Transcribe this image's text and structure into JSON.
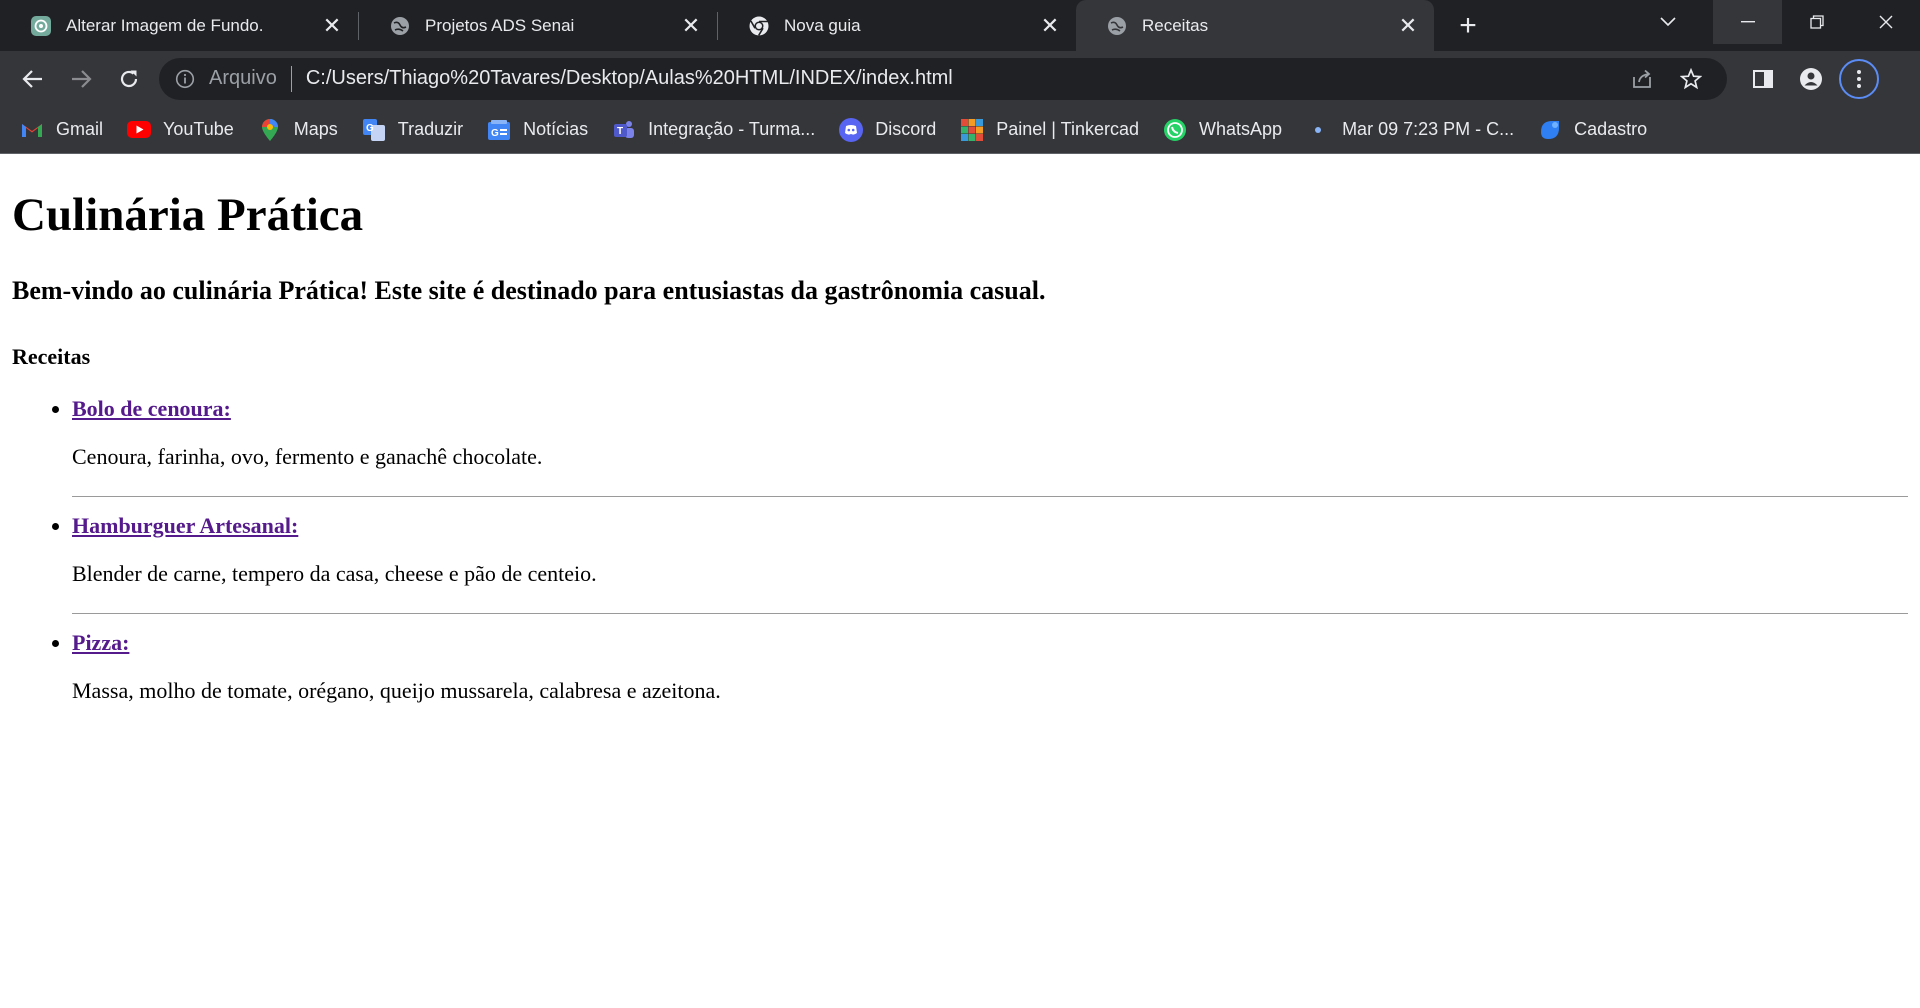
{
  "browser": {
    "tabs": [
      {
        "title": "Alterar Imagem de Fundo.",
        "icon": "chatgpt-icon",
        "active": false
      },
      {
        "title": "Projetos ADS Senai",
        "icon": "globe-icon",
        "active": false
      },
      {
        "title": "Nova guia",
        "icon": "chrome-icon",
        "active": false
      },
      {
        "title": "Receitas",
        "icon": "globe-icon",
        "active": true
      }
    ],
    "close_glyph": "✕",
    "new_tab_glyph": "+",
    "address": {
      "scheme_label": "Arquivo",
      "url": "C:/Users/Thiago%20Tavares/Desktop/Aulas%20HTML/INDEX/index.html"
    },
    "bookmarks": [
      {
        "label": "Gmail",
        "icon": "gmail-icon"
      },
      {
        "label": "YouTube",
        "icon": "youtube-icon"
      },
      {
        "label": "Maps",
        "icon": "maps-icon"
      },
      {
        "label": "Traduzir",
        "icon": "translate-icon"
      },
      {
        "label": "Notícias",
        "icon": "news-icon"
      },
      {
        "label": "Integração - Turma...",
        "icon": "teams-icon"
      },
      {
        "label": "Discord",
        "icon": "discord-icon"
      },
      {
        "label": "Painel | Tinkercad",
        "icon": "tinkercad-icon"
      },
      {
        "label": "WhatsApp",
        "icon": "whatsapp-icon"
      },
      {
        "label": "Mar 09 7:23 PM - C...",
        "icon": "dot-icon"
      },
      {
        "label": "Cadastro",
        "icon": "cadastro-icon"
      }
    ],
    "colors": {
      "frame": "#202124",
      "toolbar": "#35363a",
      "text": "#e8eaed",
      "accent": "#5b8cf5"
    }
  },
  "page": {
    "heading": "Culinária Prática",
    "welcome": "Bem-vindo ao culinária Prática! Este site é destinado para entusiastas da gastrônomia casual.",
    "section_title": "Receitas",
    "recipes": [
      {
        "name": "Bolo de cenoura:",
        "ingredients": "Cenoura, farinha, ovo, fermento e ganachê chocolate."
      },
      {
        "name": "Hamburguer Artesanal:",
        "ingredients": "Blender de carne, tempero da casa, cheese e pão de centeio."
      },
      {
        "name": "Pizza:",
        "ingredients": "Massa, molho de tomate, orégano, queijo mussarela, calabresa e azeitona."
      }
    ],
    "link_color": "#551a8b"
  }
}
